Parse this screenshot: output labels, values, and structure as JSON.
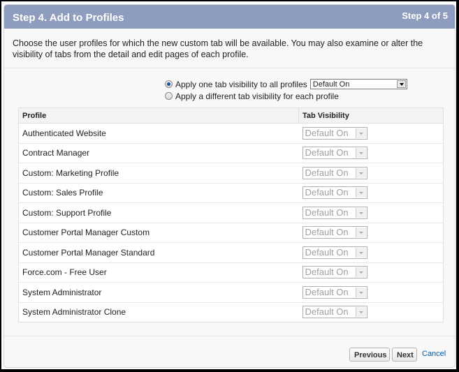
{
  "header": {
    "title": "Step 4. Add to Profiles",
    "step_indicator": "Step 4 of 5"
  },
  "intro": "Choose the user profiles for which the new custom tab will be available. You may also examine or alter the visibility of tabs from the detail and edit pages of each profile.",
  "options": {
    "apply_all_label": "Apply one tab visibility to all profiles",
    "apply_all_selected": true,
    "apply_all_value": "Default On",
    "apply_each_label": "Apply a different tab visibility for each profile",
    "apply_each_selected": false
  },
  "table": {
    "headers": {
      "profile": "Profile",
      "visibility": "Tab Visibility"
    },
    "rows": [
      {
        "profile": "Authenticated Website",
        "visibility": "Default On"
      },
      {
        "profile": "Contract Manager",
        "visibility": "Default On"
      },
      {
        "profile": "Custom: Marketing Profile",
        "visibility": "Default On"
      },
      {
        "profile": "Custom: Sales Profile",
        "visibility": "Default On"
      },
      {
        "profile": "Custom: Support Profile",
        "visibility": "Default On"
      },
      {
        "profile": "Customer Portal Manager Custom",
        "visibility": "Default On"
      },
      {
        "profile": "Customer Portal Manager Standard",
        "visibility": "Default On"
      },
      {
        "profile": "Force.com - Free User",
        "visibility": "Default On"
      },
      {
        "profile": "System Administrator",
        "visibility": "Default On"
      },
      {
        "profile": "System Administrator Clone",
        "visibility": "Default On"
      }
    ]
  },
  "footer": {
    "previous_label": "Previous",
    "next_label": "Next",
    "cancel_label": "Cancel"
  }
}
